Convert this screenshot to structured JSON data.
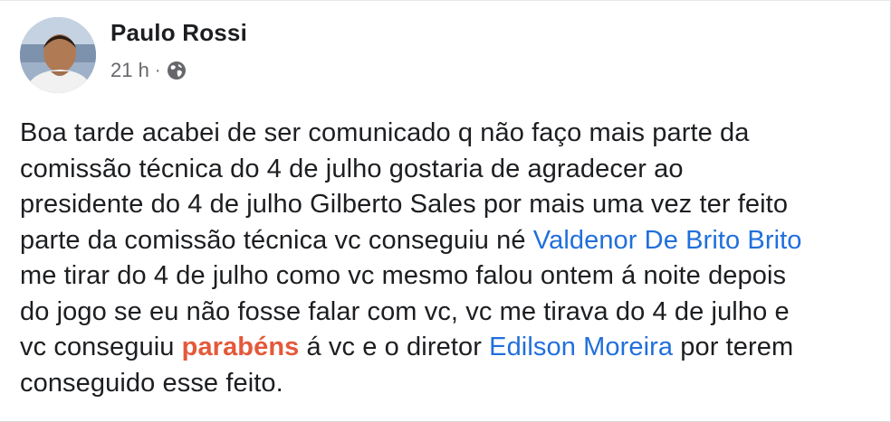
{
  "author": {
    "name": "Paulo Rossi"
  },
  "meta": {
    "time": "21 h",
    "separator": "·",
    "audience_icon": "globe-icon"
  },
  "post": {
    "segments": {
      "s1": "Boa tarde acabei de ser comunicado q não faço mais parte da\ncomissão técnica do 4 de julho gostaria de agradecer ao\npresidente do 4 de julho Gilberto Sales por mais uma vez ter feito\nparte da comissão técnica vc conseguiu né ",
      "mention1": "Valdenor De Brito Brito",
      "s2": "\nme tirar do 4 de julho como vc mesmo falou ontem á noite depois\ndo jogo se eu não fosse falar com vc, vc me tirava do 4 de julho e\nvc conseguiu ",
      "highlight": "parabéns",
      "s3": " á vc e o diretor ",
      "mention2": "Edilson Moreira",
      "s4": " por terem\nconseguido esse feito."
    }
  },
  "colors": {
    "mention": "#216fdb",
    "highlight": "#e4593a",
    "text": "#1c1e21",
    "meta": "#65676b"
  }
}
